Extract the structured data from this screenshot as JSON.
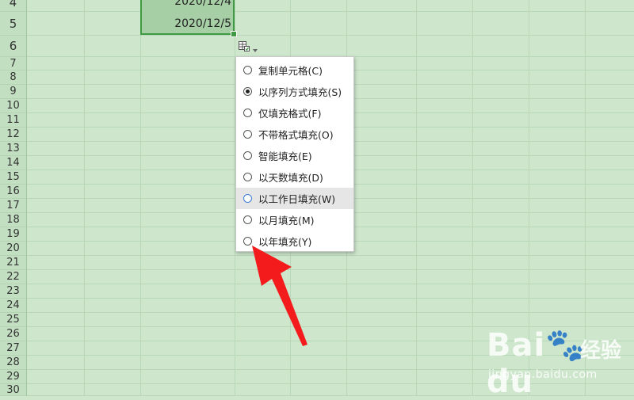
{
  "rows": [
    "4",
    "5",
    "6",
    "7",
    "8",
    "9",
    "10",
    "11",
    "12",
    "13",
    "14",
    "15",
    "16",
    "17",
    "18",
    "19",
    "20",
    "21",
    "22",
    "23",
    "24",
    "25",
    "26",
    "27",
    "28",
    "29",
    "30"
  ],
  "cells": [
    {
      "row": "4",
      "value": "2020/12/4"
    },
    {
      "row": "5",
      "value": "2020/12/5"
    }
  ],
  "autofill": {
    "icon": "autofill-options-icon",
    "dropdown_icon": "small-down-arrow-icon"
  },
  "menu": {
    "items": [
      {
        "label": "复制单元格(C)",
        "checked": false
      },
      {
        "label": "以序列方式填充(S)",
        "checked": true
      },
      {
        "label": "仅填充格式(F)",
        "checked": false
      },
      {
        "label": "不带格式填充(O)",
        "checked": false
      },
      {
        "label": "智能填充(E)",
        "checked": false
      },
      {
        "label": "以天数填充(D)",
        "checked": false
      },
      {
        "label": "以工作日填充(W)",
        "checked": false,
        "hovered": true
      },
      {
        "label": "以月填充(M)",
        "checked": false
      },
      {
        "label": "以年填充(Y)",
        "checked": false
      }
    ]
  },
  "annotation": {
    "icon": "red-arrow-icon",
    "color": "#f31b1b"
  },
  "watermark": {
    "brand": "Bai",
    "brand_suffix": "du",
    "cn": "经验",
    "url": "jingyan.baidu.com"
  },
  "colors": {
    "sheet_bg": "#cde6cc",
    "selection_border": "#3f9a43",
    "selection_fill": "#a7cfa6"
  }
}
